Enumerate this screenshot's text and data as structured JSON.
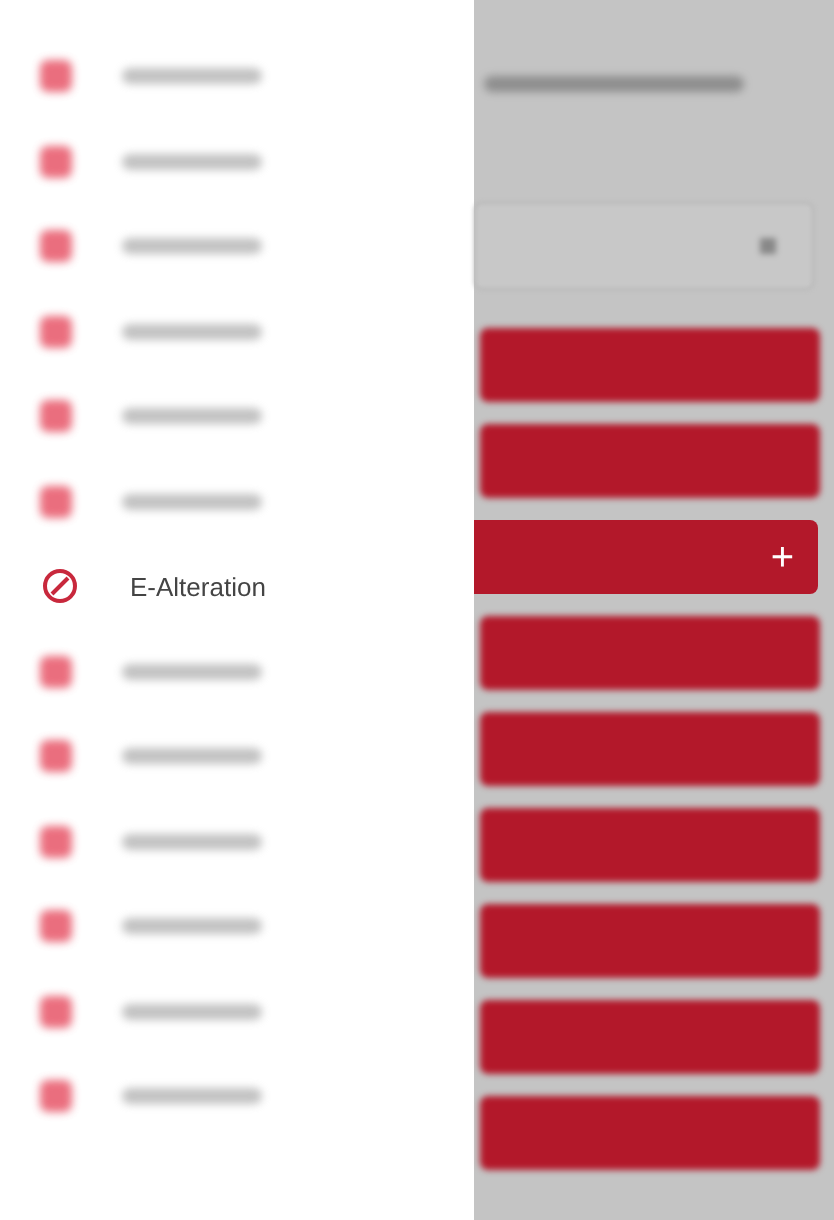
{
  "drawer": {
    "items": [
      {
        "kind": "blurred"
      },
      {
        "kind": "blurred"
      },
      {
        "kind": "blurred"
      },
      {
        "kind": "blurred"
      },
      {
        "kind": "blurred"
      },
      {
        "kind": "blurred"
      },
      {
        "kind": "clear",
        "label": "E-Alteration"
      },
      {
        "kind": "blurred"
      },
      {
        "kind": "blurred"
      },
      {
        "kind": "blurred"
      },
      {
        "kind": "blurred"
      },
      {
        "kind": "blurred"
      },
      {
        "kind": "blurred"
      }
    ]
  },
  "content": {
    "bars": [
      {
        "kind": "blurred"
      },
      {
        "kind": "blurred"
      },
      {
        "kind": "clear",
        "icon": "+"
      },
      {
        "kind": "blurred"
      },
      {
        "kind": "blurred"
      },
      {
        "kind": "blurred"
      },
      {
        "kind": "blurred"
      },
      {
        "kind": "blurred"
      },
      {
        "kind": "blurred"
      }
    ]
  }
}
